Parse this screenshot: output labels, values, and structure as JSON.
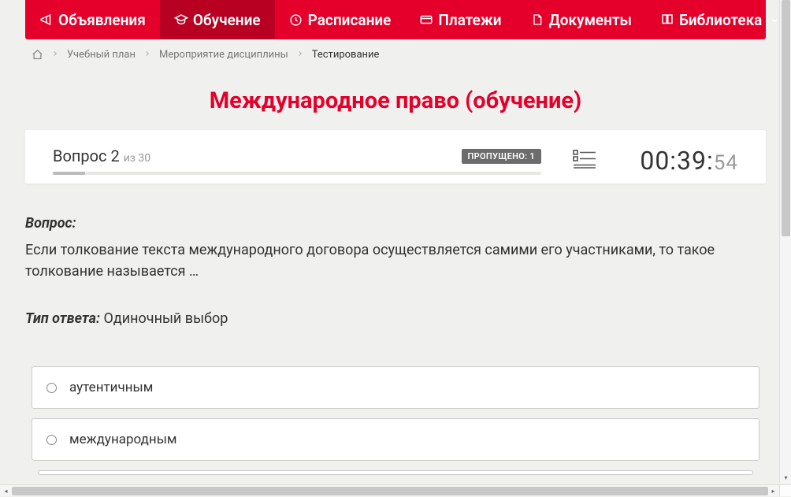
{
  "nav": {
    "items": [
      {
        "label": "Объявления",
        "icon": "megaphone"
      },
      {
        "label": "Обучение",
        "icon": "graduation-cap",
        "active": true
      },
      {
        "label": "Расписание",
        "icon": "clock"
      },
      {
        "label": "Платежи",
        "icon": "card"
      },
      {
        "label": "Документы",
        "icon": "document"
      },
      {
        "label": "Библиотека",
        "icon": "book",
        "dropdown": true
      }
    ]
  },
  "breadcrumbs": {
    "items": [
      "Учебный план",
      "Мероприятие дисциплины"
    ],
    "current": "Тестирование"
  },
  "page_title": "Международное право (обучение)",
  "question_panel": {
    "label": "Вопрос",
    "current": "2",
    "of_word": "из",
    "total": "30",
    "skipped_label": "ПРОПУЩЕНО: 1",
    "timer_main": "00:39:",
    "timer_seconds": "54"
  },
  "question": {
    "label": "Вопрос:",
    "text": "Если толкование текста международного договора осуществляется самими его участниками, то такое толкование называется …"
  },
  "answer_type": {
    "label": "Тип ответа:",
    "value": "Одиночный выбор"
  },
  "answers": [
    "аутентичным",
    "международным"
  ]
}
